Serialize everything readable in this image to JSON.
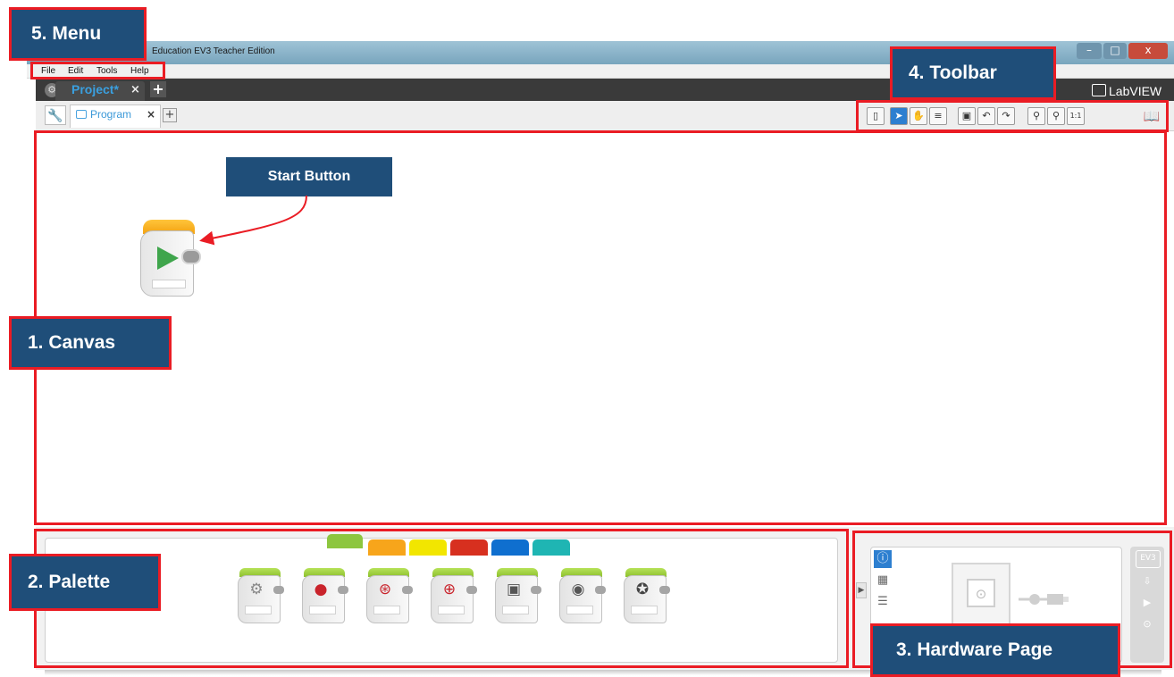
{
  "window": {
    "title": "Education EV3 Teacher Edition",
    "buttons": {
      "minimize": "–",
      "maximize": "□",
      "close": "x"
    }
  },
  "menu": {
    "items": [
      "File",
      "Edit",
      "Tools",
      "Help"
    ]
  },
  "project_tab": {
    "label": "Project*",
    "close": "×",
    "add": "+"
  },
  "brand": {
    "logo_text": "LabVIEW"
  },
  "program_tab": {
    "label": "Program",
    "close": "×",
    "add": "+"
  },
  "toolbar": {
    "icons": [
      "new-page-icon",
      "pointer-icon",
      "pan-hand-icon",
      "comment-icon",
      "save-icon",
      "undo-icon",
      "redo-icon",
      "zoom-out-icon",
      "zoom-in-icon",
      "zoom-reset-icon",
      "help-book-icon"
    ],
    "zoom_reset_label": "1:1"
  },
  "canvas": {
    "blocks": [
      "start-block"
    ]
  },
  "palette": {
    "tab_colors": [
      "#8dc63f",
      "#f7a51b",
      "#f2e600",
      "#d7301f",
      "#0f6fcf",
      "#1fb5b3"
    ],
    "blocks": [
      "medium-motor-block",
      "large-motor-block",
      "move-steering-block",
      "move-tank-block",
      "display-block",
      "sound-block",
      "brick-status-light-block"
    ]
  },
  "hardware_page": {
    "brick_label": "EV3"
  },
  "annotations": {
    "menu": "5. Menu",
    "toolbar": "4. Toolbar",
    "start_button": "Start Button",
    "canvas": "1. Canvas",
    "palette": "2. Palette",
    "hardware_page": "3. Hardware Page"
  },
  "colors": {
    "annotation_box": "#ea1c24",
    "annotation_label": "#1f4e79",
    "project_tab_text": "#3aa0e0",
    "start_block_top": "#f7a51b",
    "start_play": "#3fa54c"
  }
}
